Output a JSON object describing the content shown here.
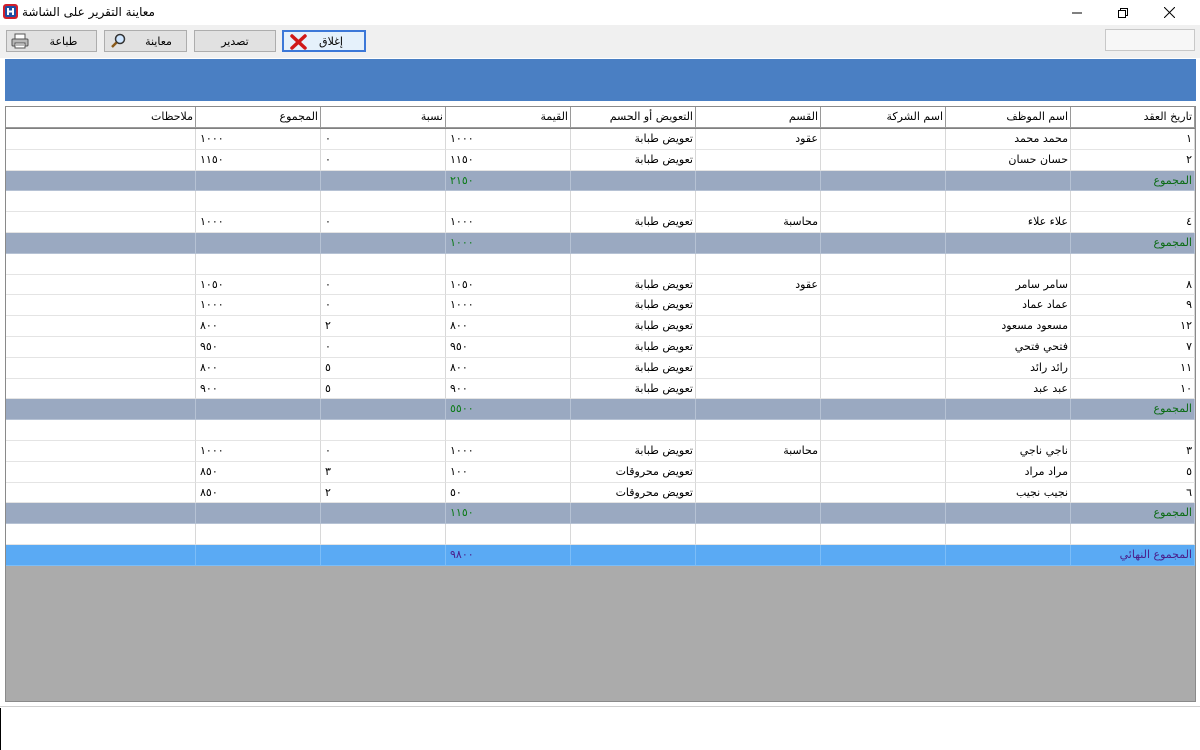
{
  "window": {
    "title": "معاينة التقرير على الشاشة",
    "controls": {
      "minimize": "minimize-icon",
      "maximize": "restore-icon",
      "close": "close-icon"
    }
  },
  "toolbar": {
    "print_label": "طباعة",
    "preview_label": "معاينة",
    "export_label": "تصدير",
    "close_label": "إغلاق",
    "field_value": ""
  },
  "colors": {
    "banner": "#4a7fc3",
    "subtotal_row": "#9aa9c1",
    "final_row": "#5aaaf4",
    "report_bg": "#ababab"
  },
  "report": {
    "columns": [
      "تاريخ العقد",
      "اسم الموظف",
      "اسم الشركة",
      "القسم",
      "التعويض أو الحسم",
      "القيمة",
      "نسبة",
      "المجموع",
      "ملاحظات"
    ],
    "rows": [
      {
        "type": "data",
        "cells": [
          "١",
          "محمد محمد",
          "",
          "عقود",
          "تعويض طبابة",
          "١٠٠٠",
          "٠",
          "١٠٠٠",
          ""
        ]
      },
      {
        "type": "data",
        "cells": [
          "٢",
          "حسان حسان",
          "",
          "",
          "تعويض طبابة",
          "١١٥٠",
          "٠",
          "١١٥٠",
          ""
        ]
      },
      {
        "type": "subtotal",
        "label": "المجموع",
        "value": "٢١٥٠"
      },
      {
        "type": "blank"
      },
      {
        "type": "data",
        "cells": [
          "٤",
          "علاء علاء",
          "",
          "محاسبة",
          "تعويض طبابة",
          "١٠٠٠",
          "٠",
          "١٠٠٠",
          ""
        ]
      },
      {
        "type": "subtotal",
        "label": "المجموع",
        "value": "١٠٠٠"
      },
      {
        "type": "blank"
      },
      {
        "type": "data",
        "cells": [
          "٨",
          "سامر سامر",
          "",
          "عقود",
          "تعويض طبابة",
          "١٠٥٠",
          "٠",
          "١٠٥٠",
          ""
        ]
      },
      {
        "type": "data",
        "cells": [
          "٩",
          "عماد عماد",
          "",
          "",
          "تعويض طبابة",
          "١٠٠٠",
          "٠",
          "١٠٠٠",
          ""
        ]
      },
      {
        "type": "data",
        "cells": [
          "١٢",
          "مسعود مسعود",
          "",
          "",
          "تعويض طبابة",
          "٨٠٠",
          "٢",
          "٨٠٠",
          ""
        ]
      },
      {
        "type": "data",
        "cells": [
          "٧",
          "فتحي فتحي",
          "",
          "",
          "تعويض طبابة",
          "٩٥٠",
          "٠",
          "٩٥٠",
          ""
        ]
      },
      {
        "type": "data",
        "cells": [
          "١١",
          "رائد رائد",
          "",
          "",
          "تعويض طبابة",
          "٨٠٠",
          "٥",
          "٨٠٠",
          ""
        ]
      },
      {
        "type": "data",
        "cells": [
          "١٠",
          "عبد عبد",
          "",
          "",
          "تعويض طبابة",
          "٩٠٠",
          "٥",
          "٩٠٠",
          ""
        ]
      },
      {
        "type": "subtotal",
        "label": "المجموع",
        "value": "٥٥٠٠"
      },
      {
        "type": "blank"
      },
      {
        "type": "data",
        "cells": [
          "٣",
          "ناجي ناجي",
          "",
          "محاسبة",
          "تعويض طبابة",
          "١٠٠٠",
          "٠",
          "١٠٠٠",
          ""
        ]
      },
      {
        "type": "data",
        "cells": [
          "٥",
          "مراد مراد",
          "",
          "",
          "تعويض محروقات",
          "١٠٠",
          "٣",
          "٨٥٠",
          ""
        ]
      },
      {
        "type": "data",
        "cells": [
          "٦",
          "نجيب نجيب",
          "",
          "",
          "تعويض محروقات",
          "٥٠",
          "٢",
          "٨٥٠",
          ""
        ]
      },
      {
        "type": "subtotal",
        "label": "المجموع",
        "value": "١١٥٠"
      },
      {
        "type": "blank"
      },
      {
        "type": "final",
        "label": "المجموع النهائي",
        "value": "٩٨٠٠"
      }
    ]
  }
}
